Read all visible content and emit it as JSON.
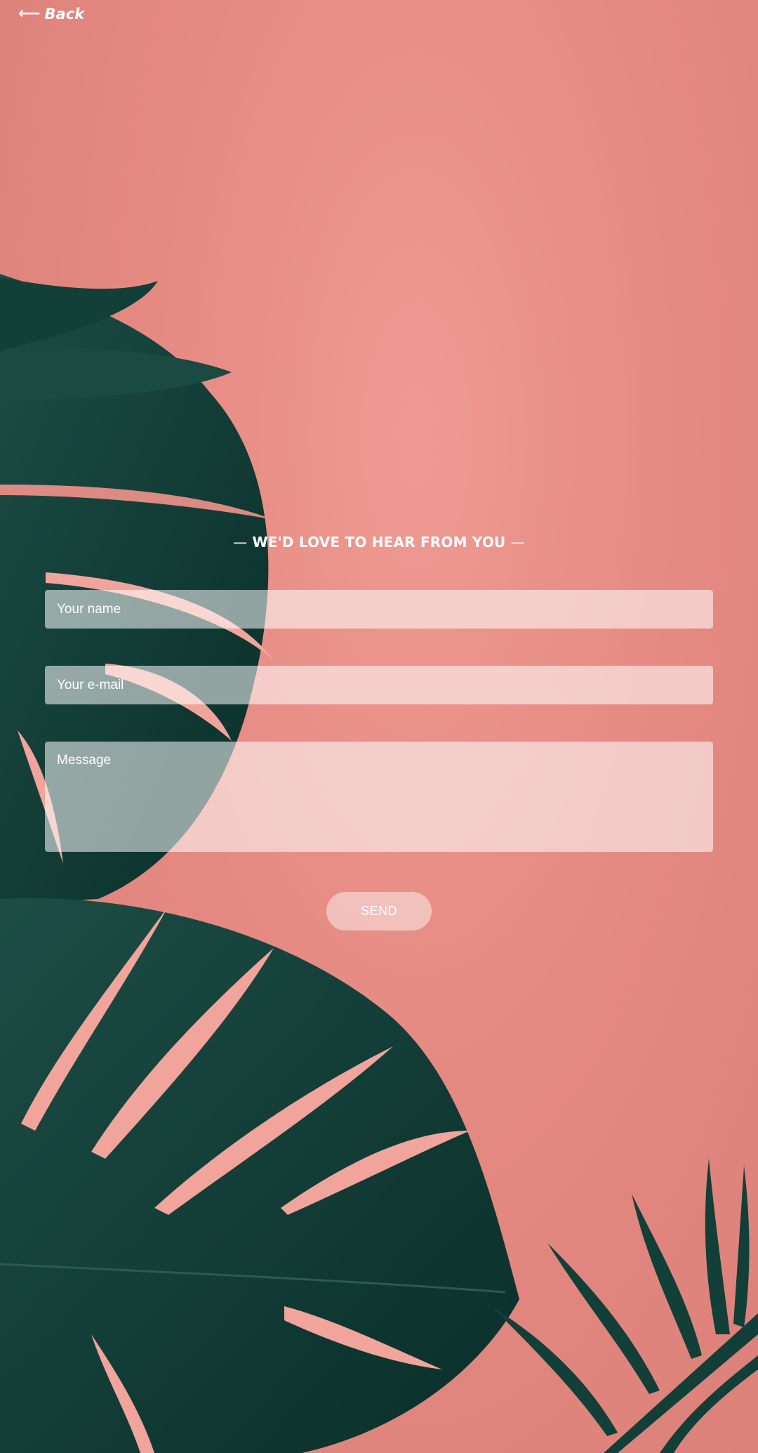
{
  "nav": {
    "back_label": "Back",
    "back_icon": "arrow-left-icon"
  },
  "contact": {
    "heading": "WE'D LOVE TO HEAR FROM YOU",
    "heading_dash": "—",
    "name_placeholder": "Your name",
    "email_placeholder": "Your e-mail",
    "message_placeholder": "Message",
    "send_label": "SEND"
  },
  "colors": {
    "background": "#e88e86",
    "leaf": "#0f3a33",
    "text": "#ffffff"
  }
}
